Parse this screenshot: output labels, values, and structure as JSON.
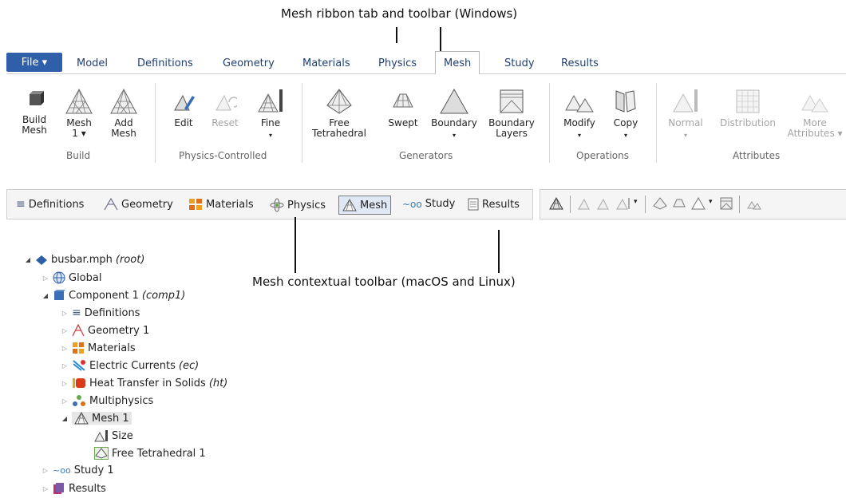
{
  "captions": {
    "top": "Mesh ribbon tab and toolbar (Windows)",
    "middle": "Mesh contextual toolbar (macOS and Linux)"
  },
  "ribbon": {
    "file_label": "File ▾",
    "tabs": [
      "Model",
      "Definitions",
      "Geometry",
      "Materials",
      "Physics",
      "Mesh",
      "Study",
      "Results"
    ],
    "active_tab": "Mesh",
    "buttons": {
      "build_mesh": [
        "Build",
        "Mesh"
      ],
      "mesh1": [
        "Mesh",
        "1 ▾"
      ],
      "add_mesh": [
        "Add",
        "Mesh"
      ],
      "edit": [
        "Edit"
      ],
      "reset": [
        "Reset"
      ],
      "fine": [
        "Fine"
      ],
      "free_tet": [
        "Free",
        "Tetrahedral"
      ],
      "swept": [
        "Swept"
      ],
      "boundary": [
        "Boundary"
      ],
      "boundary_layers": [
        "Boundary",
        "Layers"
      ],
      "modify": [
        "Modify"
      ],
      "copy": [
        "Copy"
      ],
      "normal": [
        "Normal"
      ],
      "distribution": [
        "Distribution"
      ],
      "more_attributes": [
        "More",
        "Attributes ▾"
      ]
    },
    "groups": {
      "build": "Build",
      "physics_controlled": "Physics-Controlled",
      "generators": "Generators",
      "operations": "Operations",
      "attributes": "Attributes"
    },
    "caret": "▾"
  },
  "toolbar": {
    "items": [
      "Definitions",
      "Geometry",
      "Materials",
      "Physics",
      "Mesh",
      "Study",
      "Results"
    ],
    "active": "Mesh"
  },
  "tree": {
    "root_name": "busbar.mph",
    "root_tag": "(root)",
    "global": "Global",
    "component": "Component 1",
    "component_tag": "(comp1)",
    "definitions": "Definitions",
    "geometry": "Geometry 1",
    "materials": "Materials",
    "electric": "Electric Currents",
    "electric_tag": "(ec)",
    "heat": "Heat Transfer in Solids",
    "heat_tag": "(ht)",
    "multiphysics": "Multiphysics",
    "mesh": "Mesh 1",
    "size": "Size",
    "free_tet": "Free Tetrahedral 1",
    "study": "Study 1",
    "results": "Results"
  },
  "colors": {
    "file_tab": "#2f5fa8",
    "tab_text": "#1f3f74",
    "active_toolbar": "#dfe8f4"
  }
}
